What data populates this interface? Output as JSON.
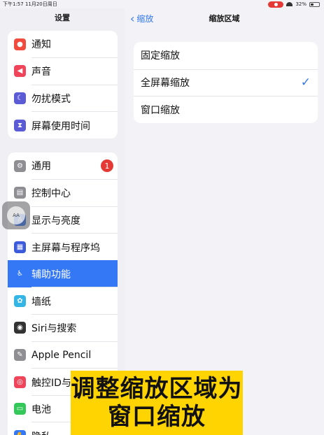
{
  "status_bar": {
    "time_date": "下午1:57  11月20日周日",
    "battery": "32%"
  },
  "left": {
    "title": "设置",
    "group1": [
      {
        "label": "通知",
        "icon": "bell-icon",
        "color": "#f04b3d",
        "glyph": "●"
      },
      {
        "label": "声音",
        "icon": "speaker-icon",
        "color": "#f0445a",
        "glyph": "◀"
      },
      {
        "label": "勿扰模式",
        "icon": "moon-icon",
        "color": "#5b5bd6",
        "glyph": "☾"
      },
      {
        "label": "屏幕使用时间",
        "icon": "hourglass-icon",
        "color": "#5b5bd6",
        "glyph": "⧗"
      }
    ],
    "group2": [
      {
        "label": "通用",
        "icon": "gear-icon",
        "color": "#8e8e93",
        "glyph": "⚙",
        "badge": "1"
      },
      {
        "label": "控制中心",
        "icon": "switches-icon",
        "color": "#8e8e93",
        "glyph": "▤"
      },
      {
        "label": "显示与亮度",
        "icon": "brightness-icon",
        "color": "#3478f6",
        "glyph": "A"
      },
      {
        "label": "主屏幕与程序坞",
        "icon": "grid-icon",
        "color": "#3b5bdb",
        "glyph": "▦"
      },
      {
        "label": "辅助功能",
        "icon": "accessibility-icon",
        "color": "#3478f6",
        "glyph": "♿",
        "selected": true
      },
      {
        "label": "墙纸",
        "icon": "flower-icon",
        "color": "#33b5e5",
        "glyph": "✿"
      },
      {
        "label": "Siri与搜索",
        "icon": "siri-icon",
        "color": "#333333",
        "glyph": "◉"
      },
      {
        "label": "Apple Pencil",
        "icon": "pencil-icon",
        "color": "#8e8e93",
        "glyph": "✎"
      },
      {
        "label": "触控ID与",
        "icon": "fingerprint-icon",
        "color": "#f0445a",
        "glyph": "◎"
      },
      {
        "label": "电池",
        "icon": "battery-icon",
        "color": "#34c759",
        "glyph": "▭"
      },
      {
        "label": "隐私",
        "icon": "hand-icon",
        "color": "#3478f6",
        "glyph": "✋"
      }
    ]
  },
  "right": {
    "back": "缩放",
    "title": "缩放区域",
    "options": [
      {
        "label": "固定缩放",
        "checked": false
      },
      {
        "label": "全屏幕缩放",
        "checked": true
      },
      {
        "label": "窗口缩放",
        "checked": false
      }
    ],
    "check_glyph": "✓"
  },
  "assistive_touch": {
    "label": "AA"
  },
  "caption": {
    "line1": "调整缩放区域为",
    "line2": "窗口缩放"
  }
}
